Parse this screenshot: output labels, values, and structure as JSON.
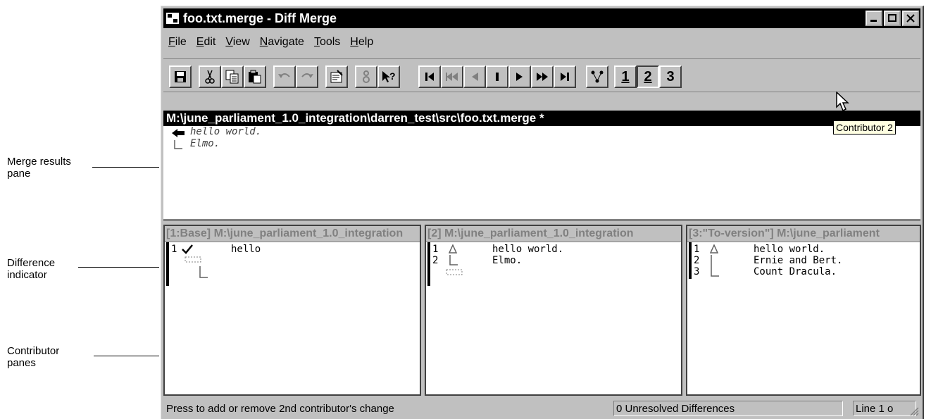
{
  "callouts": {
    "merge_results": "Merge results\npane",
    "difference_indicator": "Difference\nindicator",
    "contributor_panes": "Contributor\npanes"
  },
  "window": {
    "title": "foo.txt.merge - Diff Merge",
    "controls": [
      "minimize-icon",
      "maximize-icon",
      "close-icon"
    ]
  },
  "menu": [
    "File",
    "Edit",
    "View",
    "Navigate",
    "Tools",
    "Help"
  ],
  "toolbar": {
    "contributor_buttons": [
      "1",
      "2",
      "3"
    ],
    "active_contributor": "2"
  },
  "tooltip": "Contributor 2",
  "merge_result": {
    "path": "M:\\june_parliament_1.0_integration\\darren_test\\src\\foo.txt.merge *",
    "lines": [
      "hello world.",
      "Elmo."
    ]
  },
  "contributors": [
    {
      "header": "[1:Base] M:\\june_parliament_1.0_integration",
      "lines": [
        {
          "num": "1",
          "mark": "check",
          "text": "hello"
        }
      ]
    },
    {
      "header": "[2] M:\\june_parliament_1.0_integration",
      "lines": [
        {
          "num": "1",
          "mark": "delta",
          "text": "hello world."
        },
        {
          "num": "2",
          "mark": "corner",
          "text": "Elmo."
        }
      ]
    },
    {
      "header": "[3:\"To-version\"] M:\\june_parliament",
      "lines": [
        {
          "num": "1",
          "mark": "delta",
          "text": "hello world."
        },
        {
          "num": "2",
          "mark": "bar",
          "text": "Ernie and Bert."
        },
        {
          "num": "3",
          "mark": "corner",
          "text": "Count Dracula."
        }
      ]
    }
  ],
  "status": {
    "message": "Press to add or remove 2nd contributor's change",
    "unresolved": "0 Unresolved Differences",
    "line": "Line 1 o"
  }
}
